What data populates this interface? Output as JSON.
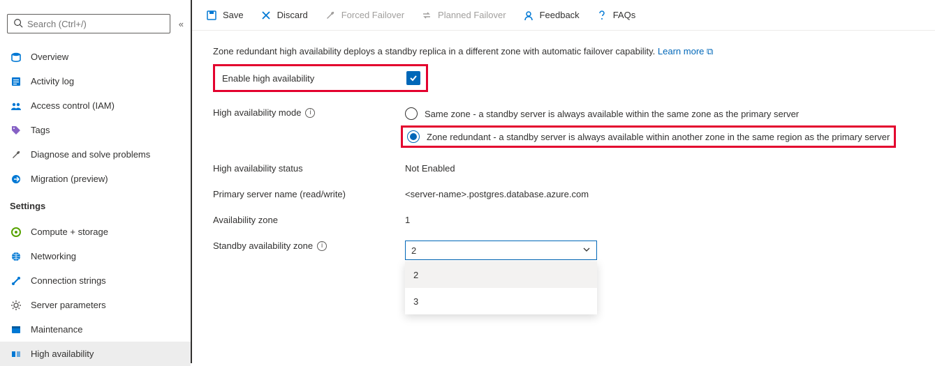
{
  "search": {
    "placeholder": "Search (Ctrl+/)"
  },
  "sidebar": {
    "items": [
      {
        "label": "Overview"
      },
      {
        "label": "Activity log"
      },
      {
        "label": "Access control (IAM)"
      },
      {
        "label": "Tags"
      },
      {
        "label": "Diagnose and solve problems"
      },
      {
        "label": "Migration (preview)"
      }
    ],
    "settings_header": "Settings",
    "settings": [
      {
        "label": "Compute + storage"
      },
      {
        "label": "Networking"
      },
      {
        "label": "Connection strings"
      },
      {
        "label": "Server parameters"
      },
      {
        "label": "Maintenance"
      },
      {
        "label": "High availability"
      }
    ]
  },
  "toolbar": {
    "save": "Save",
    "discard": "Discard",
    "forced_failover": "Forced Failover",
    "planned_failover": "Planned Failover",
    "feedback": "Feedback",
    "faqs": "FAQs"
  },
  "content": {
    "description": "Zone redundant high availability deploys a standby replica in a different zone with automatic failover capability.",
    "learn_more": "Learn more",
    "enable_label": "Enable high availability",
    "enable_checked": true,
    "ha_mode_label": "High availability mode",
    "radio_same_zone": "Same zone - a standby server is always available within the same zone as the primary server",
    "radio_zone_redundant": "Zone redundant - a standby server is always available within another zone in the same region as the primary server",
    "ha_status_label": "High availability status",
    "ha_status_value": "Not Enabled",
    "primary_server_label": "Primary server name (read/write)",
    "primary_server_value": "<server-name>.postgres.database.azure.com",
    "availability_zone_label": "Availability zone",
    "availability_zone_value": "1",
    "standby_zone_label": "Standby availability zone",
    "standby_zone_value": "2",
    "standby_options": [
      "2",
      "3"
    ]
  }
}
